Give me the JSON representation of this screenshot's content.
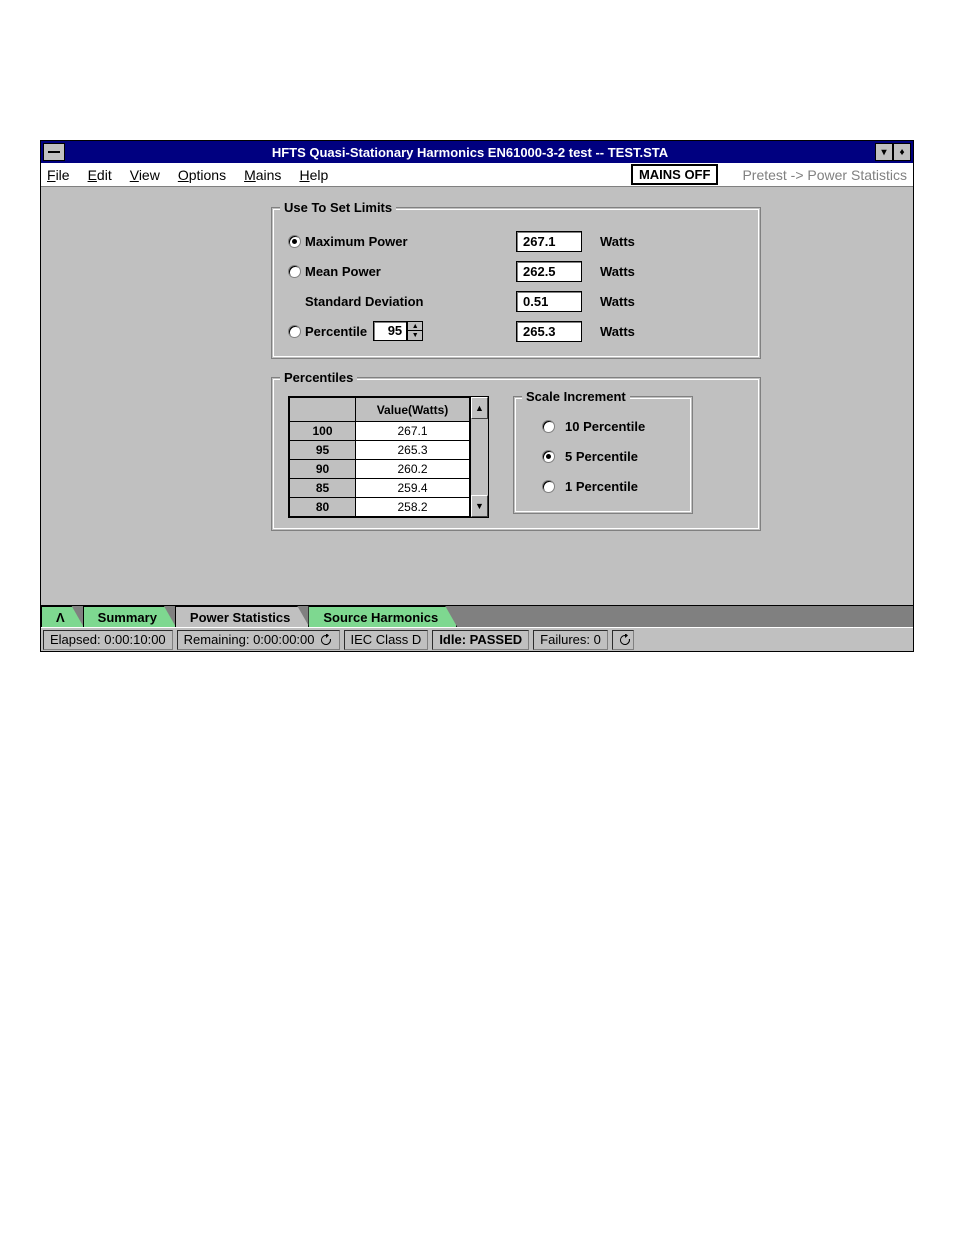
{
  "titlebar": {
    "title": "HFTS Quasi-Stationary Harmonics EN61000-3-2 test -- TEST.STA"
  },
  "menu": {
    "file": "File",
    "edit": "Edit",
    "view": "View",
    "options": "Options",
    "mains": "Mains",
    "help": "Help",
    "mains_off": "MAINS OFF",
    "pretest": "Pretest -> Power Statistics"
  },
  "limits": {
    "legend": "Use To Set Limits",
    "max_label": "Maximum Power",
    "max_val": "267.1",
    "max_unit": "Watts",
    "mean_label": "Mean Power",
    "mean_val": "262.5",
    "mean_unit": "Watts",
    "stddev_label": "Standard Deviation",
    "stddev_val": "0.51",
    "stddev_unit": "Watts",
    "pct_label": "Percentile",
    "pct_spin": "95",
    "pct_val": "265.3",
    "pct_unit": "Watts",
    "selected": "max"
  },
  "percentiles": {
    "legend": "Percentiles",
    "header_value": "Value(Watts)",
    "rows": [
      {
        "p": "100",
        "v": "267.1"
      },
      {
        "p": "95",
        "v": "265.3"
      },
      {
        "p": "90",
        "v": "260.2"
      },
      {
        "p": "85",
        "v": "259.4"
      },
      {
        "p": "80",
        "v": "258.2"
      }
    ],
    "scale": {
      "legend": "Scale Increment",
      "opt10": "10 Percentile",
      "opt5": "5 Percentile",
      "opt1": "1 Percentile",
      "selected": "5"
    }
  },
  "tabs": {
    "t1": "Λ",
    "t2": "Summary",
    "t3": "Power Statistics",
    "t4": "Source Harmonics"
  },
  "status": {
    "elapsed_label": "Elapsed:",
    "elapsed": "0:00:10:00",
    "remaining_label": "Remaining:",
    "remaining": "0:00:00:00",
    "iec": "IEC Class D",
    "idle": "Idle: PASSED",
    "failures_label": "Failures:",
    "failures": "0"
  }
}
